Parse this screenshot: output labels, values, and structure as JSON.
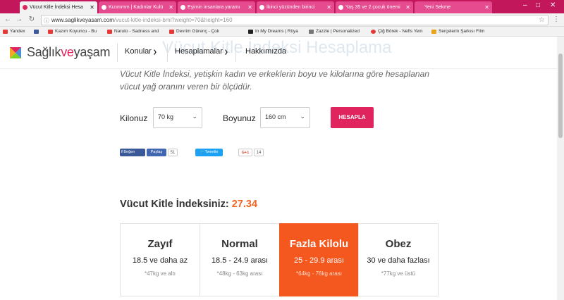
{
  "browser": {
    "tabs": [
      {
        "title": "Vücut Kitle İndeksi Hesa",
        "active": true
      },
      {
        "title": "Kızımmm | Kadınlar Kulü",
        "active": false
      },
      {
        "title": "Eşimin insanlara yaramı",
        "active": false
      },
      {
        "title": "İkinci yüzünden birinci",
        "active": false
      },
      {
        "title": "Yaş 35 ve 2.çocuk önemi",
        "active": false
      },
      {
        "title": "Yeni Sekme",
        "active": false
      }
    ],
    "url_domain": "www.saglikveyasam.com",
    "url_path": "/vucut-kitle-indeksi-bmi?weight=70&height=160",
    "bookmarks": [
      {
        "label": "Yandex",
        "color": "#e53935"
      },
      {
        "label": "",
        "color": "#3b5998"
      },
      {
        "label": "Kazım Koyuncu - Bu",
        "color": "#e53935"
      },
      {
        "label": "Naruto - Sadness and",
        "color": "#e53935"
      },
      {
        "label": "Devrim Gürenç - Çok",
        "color": "#e53935"
      },
      {
        "label": "In My Dreams | Rüya",
        "color": "#222222"
      },
      {
        "label": "Zazzle | Personalized",
        "color": "#555555"
      },
      {
        "label": "Çiğ Börek - Nefis Yem",
        "color": "#e53935"
      },
      {
        "label": "Serçelerin Şarkısı Film",
        "color": "#e8a317"
      }
    ]
  },
  "site": {
    "logo_main": "Sağlık",
    "logo_ve": "ve",
    "logo_end": "yaşam",
    "nav": [
      {
        "label": "Konular",
        "has_menu": true
      },
      {
        "label": "Hesaplamalar",
        "has_menu": true
      },
      {
        "label": "Hakkımızda",
        "has_menu": false
      }
    ],
    "ghost_title": "Vücut Kitle İndeksi Hesaplama"
  },
  "intro": "Vücut Kitle İndeksi, yetişkin kadın ve erkeklerin boyu ve kilolarına göre hesaplanan vücut yağ oranını veren bir ölçüdür.",
  "form": {
    "weight_label": "Kilonuz",
    "weight_value": "70 kg",
    "height_label": "Boyunuz",
    "height_value": "160 cm",
    "submit": "HESAPLA"
  },
  "share": {
    "fb_like": "Beğen",
    "fb_share": "Paylaş",
    "fb_count": "51",
    "tweet": "Tweetle",
    "gplus": "G+1",
    "gplus_count": "14"
  },
  "result": {
    "label": "Vücut Kitle İndeksiniz:",
    "value": "27.34"
  },
  "categories": [
    {
      "title": "Zayıf",
      "range": "18.5 ve daha az",
      "kg": "*47kg ve altı",
      "highlight": false
    },
    {
      "title": "Normal",
      "range": "18.5 - 24.9 arası",
      "kg": "*48kg - 63kg arası",
      "highlight": false
    },
    {
      "title": "Fazla Kilolu",
      "range": "25 - 29.9 arası",
      "kg": "*64kg - 76kg arası",
      "highlight": true
    },
    {
      "title": "Obez",
      "range": "30 ve daha fazlası",
      "kg": "*77kg ve üstü",
      "highlight": false
    }
  ],
  "colors": {
    "brand_pink": "#e0245e",
    "highlight_orange": "#f5581f",
    "result_orange": "#f26522"
  }
}
